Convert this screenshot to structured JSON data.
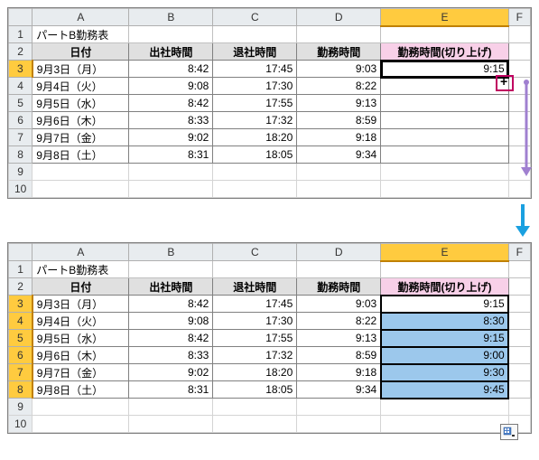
{
  "columns": [
    "",
    "A",
    "B",
    "C",
    "D",
    "E",
    "F"
  ],
  "title": "パートB勤務表",
  "headers": {
    "date": "日付",
    "start": "出社時間",
    "end": "退社時間",
    "work": "勤務時間",
    "round": "勤務時間(切り上げ)"
  },
  "rows": [
    {
      "n": "3",
      "date": "9月3日（月）",
      "s": "8:42",
      "e": "17:45",
      "w": "9:03",
      "r": "9:15"
    },
    {
      "n": "4",
      "date": "9月4日（火）",
      "s": "9:08",
      "e": "17:30",
      "w": "8:22",
      "r": "8:30"
    },
    {
      "n": "5",
      "date": "9月5日（水）",
      "s": "8:42",
      "e": "17:55",
      "w": "9:13",
      "r": "9:15"
    },
    {
      "n": "6",
      "date": "9月6日（木）",
      "s": "8:33",
      "e": "17:32",
      "w": "8:59",
      "r": "9:00"
    },
    {
      "n": "7",
      "date": "9月7日（金）",
      "s": "9:02",
      "e": "18:20",
      "w": "9:18",
      "r": "9:30"
    },
    {
      "n": "8",
      "date": "9月8日（土）",
      "s": "8:31",
      "e": "18:05",
      "w": "9:34",
      "r": "9:45"
    }
  ],
  "blank_rows": [
    "9",
    "10"
  ],
  "chart_data": {
    "type": "table",
    "title": "パートB勤務表 — autofill column E (勤務時間(切り上げ)) from E3 down to E8",
    "columns": [
      "日付",
      "出社時間",
      "退社時間",
      "勤務時間",
      "勤務時間(切り上げ)"
    ],
    "before": {
      "data": [
        [
          "9月3日（月）",
          "8:42",
          "17:45",
          "9:03",
          "9:15"
        ],
        [
          "9月4日（火）",
          "9:08",
          "17:30",
          "8:22",
          ""
        ],
        [
          "9月5日（水）",
          "8:42",
          "17:55",
          "9:13",
          ""
        ],
        [
          "9月6日（木）",
          "8:33",
          "17:32",
          "8:59",
          ""
        ],
        [
          "9月7日（金）",
          "9:02",
          "18:20",
          "9:18",
          ""
        ],
        [
          "9月8日（土）",
          "8:31",
          "18:05",
          "9:34",
          ""
        ]
      ]
    },
    "after": {
      "data": [
        [
          "9月3日（月）",
          "8:42",
          "17:45",
          "9:03",
          "9:15"
        ],
        [
          "9月4日（火）",
          "9:08",
          "17:30",
          "8:22",
          "8:30"
        ],
        [
          "9月5日（水）",
          "8:42",
          "17:55",
          "9:13",
          "9:15"
        ],
        [
          "9月6日（木）",
          "8:33",
          "17:32",
          "8:59",
          "9:00"
        ],
        [
          "9月7日（金）",
          "9:02",
          "18:20",
          "9:18",
          "9:30"
        ],
        [
          "9月8日（土）",
          "8:31",
          "18:05",
          "9:34",
          "9:45"
        ]
      ]
    }
  }
}
